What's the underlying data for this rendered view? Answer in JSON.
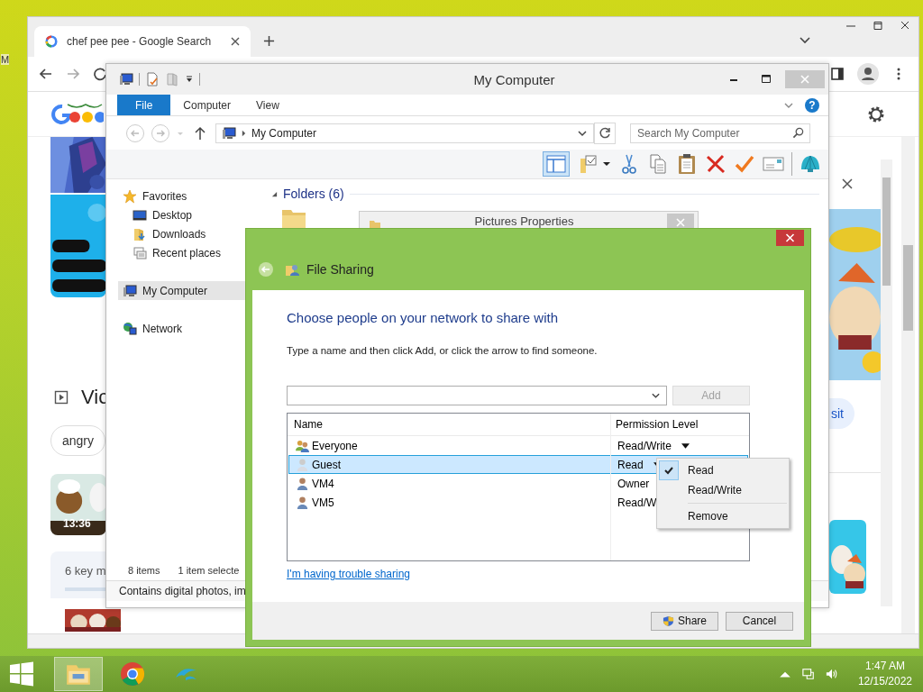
{
  "desktop": {
    "icon_label": "M"
  },
  "browser": {
    "tab": {
      "title": "chef pee pee - Google Search",
      "selected": true
    },
    "content": {
      "videos_heading": "Vic",
      "chip": "angry",
      "video_duration": "13:36",
      "key_moments": "6 key m",
      "visit_chip": "sit"
    }
  },
  "explorer": {
    "title": "My Computer",
    "ribbon_tabs": [
      {
        "label": "File",
        "selected": true
      },
      {
        "label": "Computer",
        "selected": false
      },
      {
        "label": "View",
        "selected": false
      }
    ],
    "help": "?",
    "address": "My Computer",
    "search": {
      "placeholder": "Search My Computer"
    },
    "nav": [
      {
        "label": "Favorites",
        "kind": "favorites",
        "selected": false,
        "children": [
          {
            "label": "Desktop",
            "kind": "desktop",
            "selected": false
          },
          {
            "label": "Downloads",
            "kind": "downloads",
            "selected": false
          },
          {
            "label": "Recent places",
            "kind": "recent",
            "selected": false
          }
        ]
      },
      {
        "label": "My Computer",
        "kind": "computer",
        "selected": true
      },
      {
        "label": "Network",
        "kind": "network",
        "selected": false
      }
    ],
    "section": {
      "label": "Folders (6)",
      "expanded": true
    },
    "status": {
      "items": "8 items",
      "selection": "1 item selecte"
    },
    "details": "Contains digital photos, im"
  },
  "properties_window": {
    "title": "Pictures Properties"
  },
  "dialog": {
    "title": "File Sharing",
    "heading": "Choose people on your network to share with",
    "instruction": "Type a name and then click Add, or click the arrow to find someone.",
    "add_button": {
      "label": "Add",
      "disabled": true
    },
    "columns": [
      "Name",
      "Permission Level"
    ],
    "rows": [
      {
        "name": "Everyone",
        "permission": "Read/Write",
        "kind": "group",
        "selected": false,
        "has_menu": true
      },
      {
        "name": "Guest",
        "permission": "Read",
        "kind": "guest",
        "selected": true,
        "has_menu": true
      },
      {
        "name": "VM4",
        "permission": "Owner",
        "kind": "user",
        "selected": false
      },
      {
        "name": "VM5",
        "permission": "Read/W",
        "kind": "user",
        "selected": false
      }
    ],
    "menu": [
      {
        "label": "Read",
        "kind": "option",
        "checked": true
      },
      {
        "label": "Read/Write",
        "kind": "option",
        "checked": false
      },
      {
        "label": "Remove",
        "kind": "action"
      }
    ],
    "link": "I'm having trouble sharing",
    "buttons": [
      {
        "label": "Share",
        "kind": "shield"
      },
      {
        "label": "Cancel",
        "kind": "plain"
      }
    ]
  },
  "taskbar": {
    "apps": [
      {
        "kind": "explorer",
        "selected": true
      },
      {
        "kind": "chrome",
        "selected": false
      },
      {
        "kind": "dolphin",
        "selected": false
      }
    ],
    "time": "1:47 AM",
    "date": "12/15/2022"
  }
}
